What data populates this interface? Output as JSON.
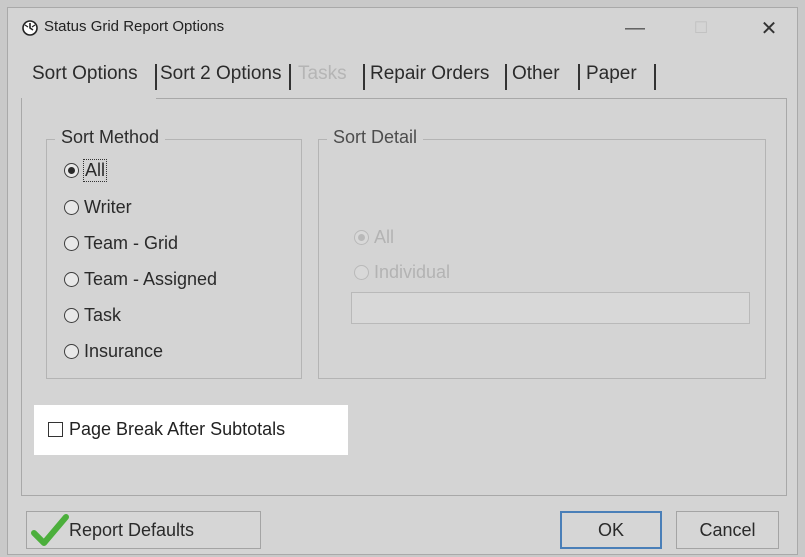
{
  "window": {
    "title": "Status Grid Report Options",
    "minimize_glyph": "—",
    "maximize_glyph": "☐",
    "close_glyph": "✕"
  },
  "tabs": [
    {
      "label": "Sort Options",
      "state": "active"
    },
    {
      "label": "Sort 2 Options",
      "state": "normal"
    },
    {
      "label": "Tasks",
      "state": "disabled"
    },
    {
      "label": "Repair Orders",
      "state": "normal"
    },
    {
      "label": "Other",
      "state": "normal"
    },
    {
      "label": "Paper",
      "state": "normal"
    }
  ],
  "sort_method": {
    "label": "Sort Method",
    "options": [
      {
        "label": "All",
        "checked": true
      },
      {
        "label": "Writer",
        "checked": false
      },
      {
        "label": "Team - Grid",
        "checked": false
      },
      {
        "label": "Team - Assigned",
        "checked": false
      },
      {
        "label": "Task",
        "checked": false
      },
      {
        "label": "Insurance",
        "checked": false
      }
    ]
  },
  "sort_detail": {
    "label": "Sort Detail",
    "options": [
      {
        "label": "All",
        "checked": true,
        "enabled": false
      },
      {
        "label": "Individual",
        "checked": false,
        "enabled": false
      }
    ],
    "input_value": ""
  },
  "page_break": {
    "label": "Page Break After Subtotals",
    "checked": false
  },
  "buttons": {
    "report_defaults": "Report Defaults",
    "ok": "OK",
    "cancel": "Cancel"
  },
  "icons": {
    "app": "clock-icon",
    "report_defaults": "checkmark-icon"
  },
  "colors": {
    "dialog_bg": "#d4d4d4",
    "highlight_bg": "#ffffff",
    "checkmark": "#4caf3c",
    "default_button_border": "#4a7fb8"
  }
}
